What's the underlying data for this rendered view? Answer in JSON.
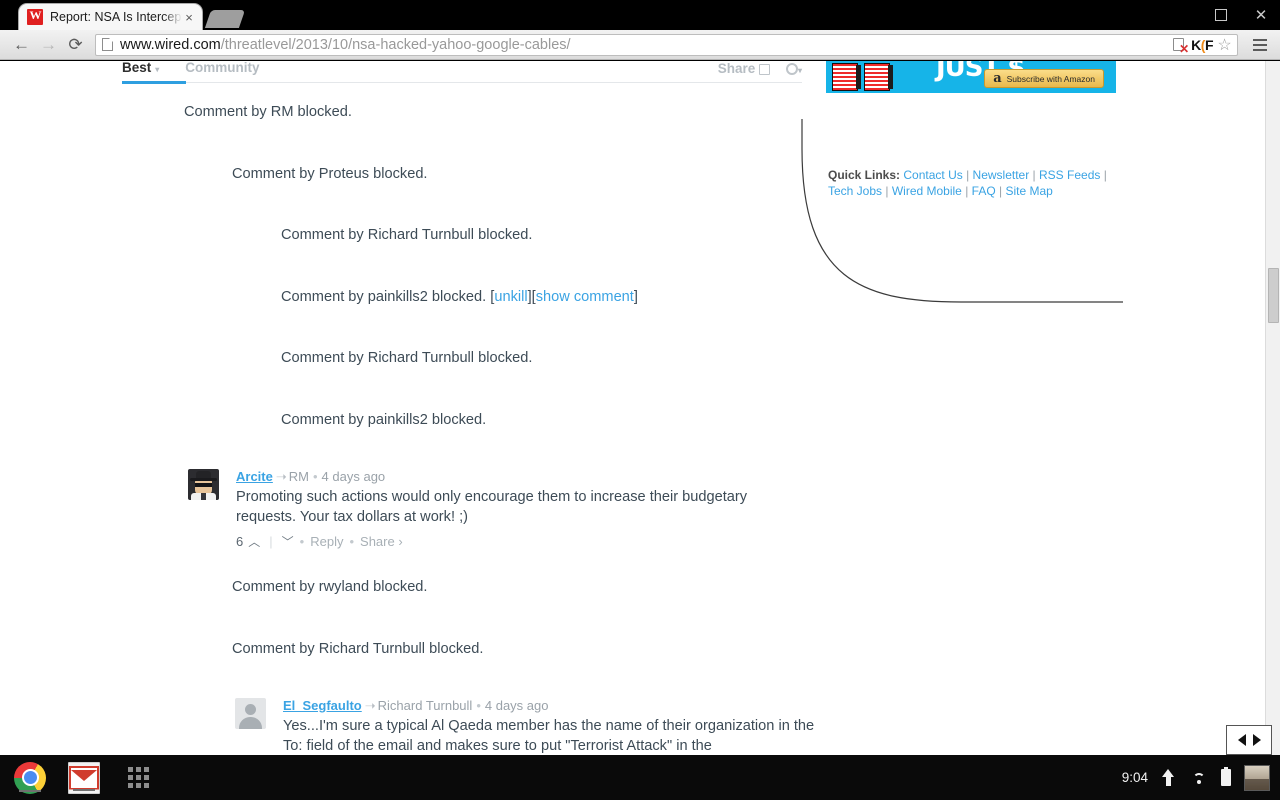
{
  "window": {
    "maximize_label": "□",
    "close_label": "✕"
  },
  "browser": {
    "tab": {
      "title": "Report: NSA Is Intercepti",
      "close_label": "×",
      "favicon": "wired-w-favicon"
    },
    "back_label": "←",
    "forward_label": "→",
    "reload_label": "⟳",
    "url_host": "www.wired.com",
    "url_path": "/threatlevel/2013/10/nsa-hacked-yahoo-google-cables/",
    "omnibox_icons": [
      "cookie-blocked-icon",
      "kill-file-icon",
      "bookmark-star-icon"
    ],
    "kf_icon_text_left": "K",
    "kf_icon_text_mid": "(",
    "kf_icon_text_right": "F",
    "star_label": "☆",
    "menu_label": "menu-icon"
  },
  "disqus": {
    "tabs": [
      {
        "label": "Best",
        "active": true,
        "caret": "▾"
      },
      {
        "label": "Community",
        "active": false
      }
    ],
    "share_label": "Share",
    "share_icon": "external-link-icon",
    "gear_icon": "gear-icon",
    "gear_caret": "▾",
    "blocked_notices": [
      {
        "text": "Comment by RM blocked.",
        "indent": 0
      },
      {
        "text": "Comment by Proteus blocked.",
        "indent": 1
      },
      {
        "text": "Comment by Richard Turnbull blocked.",
        "indent": 2
      },
      {
        "text": "Comment by painkills2 blocked.",
        "indent": 2,
        "links": [
          "unkill",
          "show comment"
        ]
      },
      {
        "text": "Comment by Richard Turnbull blocked.",
        "indent": 2
      },
      {
        "text": "Comment by painkills2 blocked.",
        "indent": 2
      }
    ],
    "comments": [
      {
        "avatar": "fedora-sunglasses-avatar",
        "user": "Arcite",
        "reply_arrow": "➝",
        "parent": "RM",
        "dot": "•",
        "time": "4 days ago",
        "text": "Promoting such actions would only encourage them to increase their budgetary requests. Your tax dollars at work! ;)",
        "votes": "6",
        "upvote": "︿",
        "downvote": "﹀",
        "reply_label": "Reply",
        "share_label": "Share ›"
      },
      {
        "avatar": "default-person-avatar",
        "user": "El_Segfaulto",
        "reply_arrow": "➝",
        "parent": "Richard Turnbull",
        "dot": "•",
        "time": "4 days ago",
        "text": "Yes...I'm sure a typical Al Qaeda member has the name of their organization in the To: field of the email and makes sure to put \"Terrorist Attack\" in the"
      }
    ],
    "blocked_after": [
      {
        "text": "Comment by rwyland blocked.",
        "indent": 1
      },
      {
        "text": "Comment by Richard Turnbull blocked.",
        "indent": 1
      }
    ]
  },
  "rail": {
    "ad": {
      "headline": "JUST $",
      "amazon_a": "a",
      "amazon_label": "Subscribe with Amazon"
    },
    "quicklinks": {
      "label": "Quick Links:",
      "separator": "|",
      "links": [
        "Contact Us",
        "Newsletter",
        "RSS Feeds",
        "Tech Jobs",
        "Wired Mobile",
        "FAQ",
        "Site Map"
      ]
    }
  },
  "scrollbar": {
    "left_arrow": "◀",
    "right_arrow": "▶"
  },
  "shelf": {
    "apps": [
      {
        "name": "chrome",
        "icon": "chrome-icon"
      },
      {
        "name": "gmail",
        "icon": "gmail-icon"
      },
      {
        "name": "launcher",
        "icon": "app-launcher-icon"
      }
    ],
    "tray": {
      "time": "9:04",
      "icons": [
        "upload-arrow-icon",
        "wifi-icon",
        "battery-icon"
      ],
      "avatar": "user-avatar"
    }
  },
  "colors": {
    "accent_blue": "#3aa3e3",
    "disqus_active": "#2e9fe0",
    "text": "#3d4b56",
    "ad_cyan": "#16b4e8"
  }
}
